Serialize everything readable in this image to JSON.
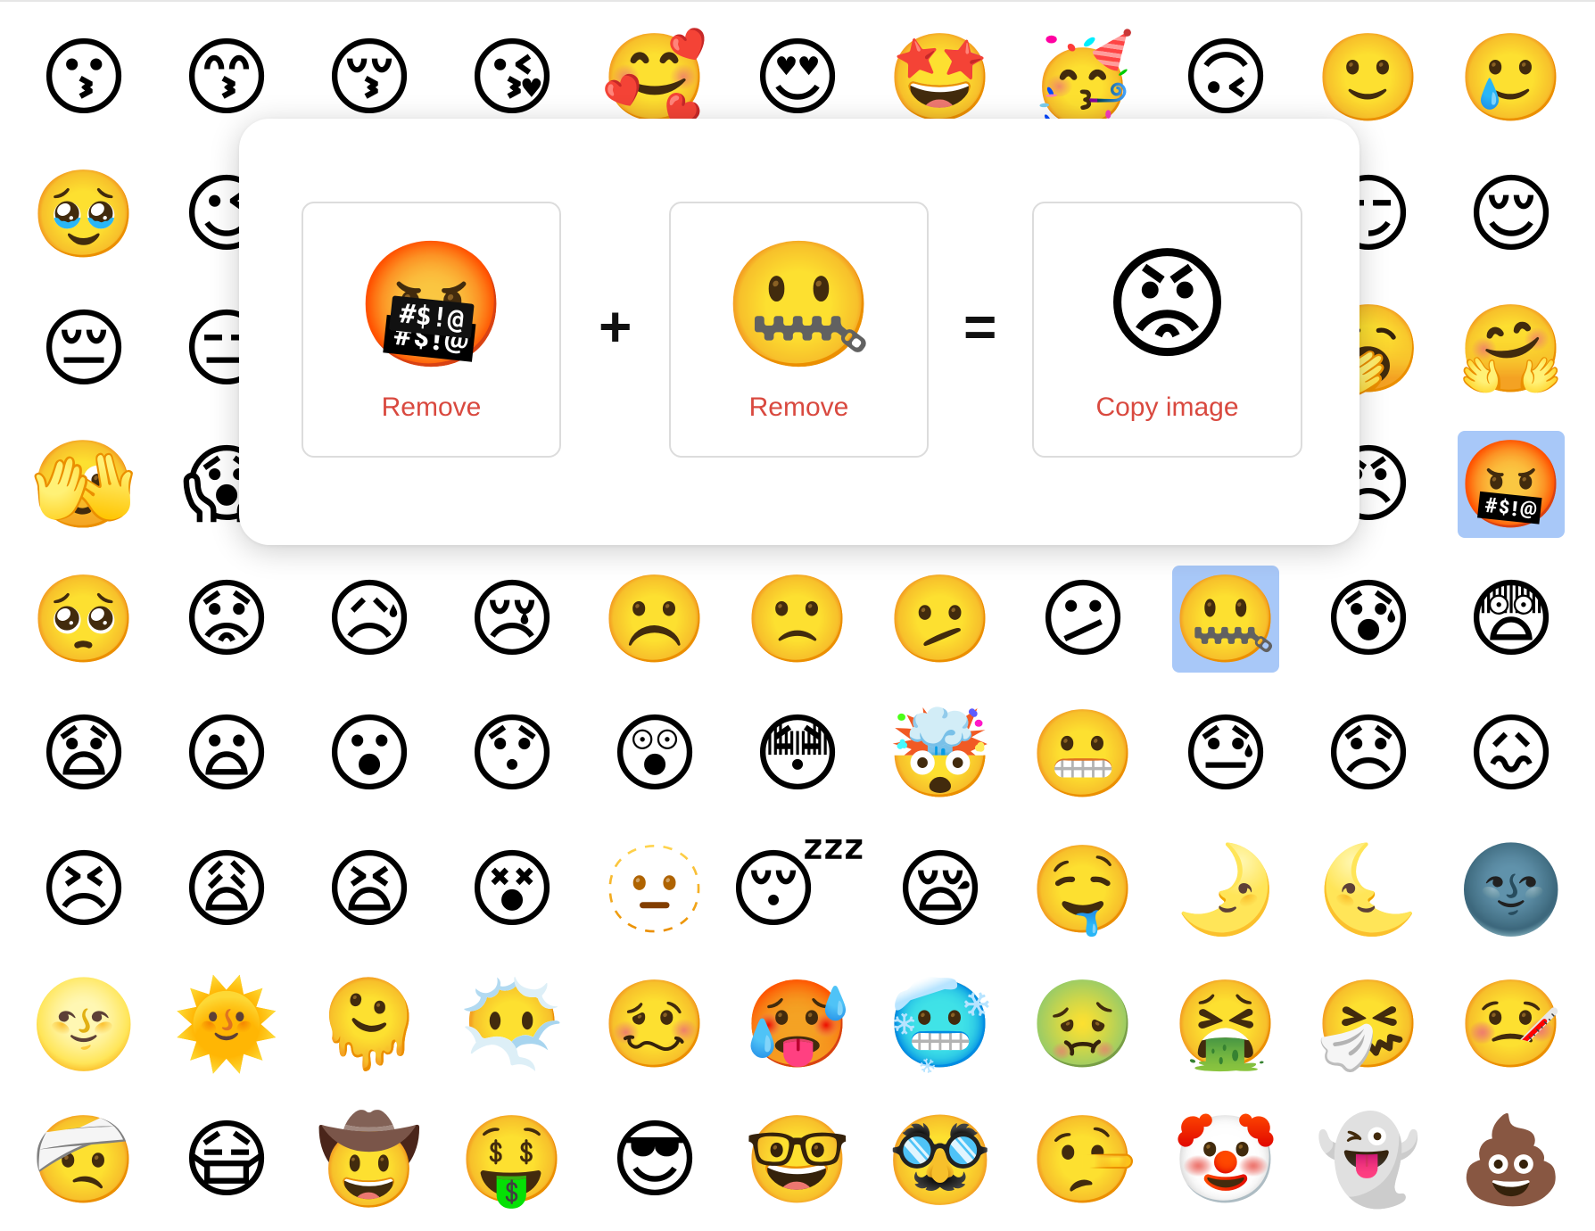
{
  "grid": {
    "rows": [
      [
        "😗",
        "😙",
        "😚",
        "😘",
        "🥰",
        "😍",
        "🤩",
        "🥳",
        "🙃",
        "🙂",
        "🥲"
      ],
      [
        "🥹",
        "😉",
        "",
        "",
        "",
        "",
        "",
        "",
        "",
        "😏",
        "😌"
      ],
      [
        "😔",
        "😑",
        "",
        "",
        "",
        "",
        "",
        "",
        "",
        "🥱",
        "🤗"
      ],
      [
        "🫣",
        "😱",
        "",
        "",
        "",
        "",
        "",
        "",
        "",
        "😠",
        "🤬"
      ],
      [
        "🥺",
        "😟",
        "😥",
        "😢",
        "☹️",
        "🙁",
        "🫤",
        "😕",
        "🤐",
        "😰",
        "😨"
      ],
      [
        "😧",
        "😦",
        "😮",
        "😯",
        "😲",
        "😳",
        "🤯",
        "😬",
        "😓",
        "😞",
        "😖"
      ],
      [
        "😣",
        "😩",
        "😫",
        "😵",
        "🫥",
        "😴",
        "😪",
        "🤤",
        "🌛",
        "🌜",
        "🌚"
      ],
      [
        "🌝",
        "🌞",
        "🫠",
        "😶‍🌫️",
        "🥴",
        "🥵",
        "🥶",
        "🤢",
        "🤮",
        "🤧",
        "🤒"
      ],
      [
        "🤕",
        "😷",
        "🤠",
        "🤑",
        "😎",
        "🤓",
        "🥸",
        "🤥",
        "🤡",
        "👻",
        "💩"
      ]
    ],
    "selected": [
      "🤬",
      "🤐"
    ]
  },
  "mixer": {
    "first": {
      "emoji": "🤬",
      "grawlix": "#$!@",
      "action": "Remove"
    },
    "plus": "+",
    "second": {
      "emoji": "🤐",
      "action": "Remove"
    },
    "equals": "=",
    "result": {
      "emoji": "😡",
      "action": "Copy image"
    }
  },
  "colors": {
    "accent": "#d9493f",
    "selection": "#a8c8f8"
  }
}
